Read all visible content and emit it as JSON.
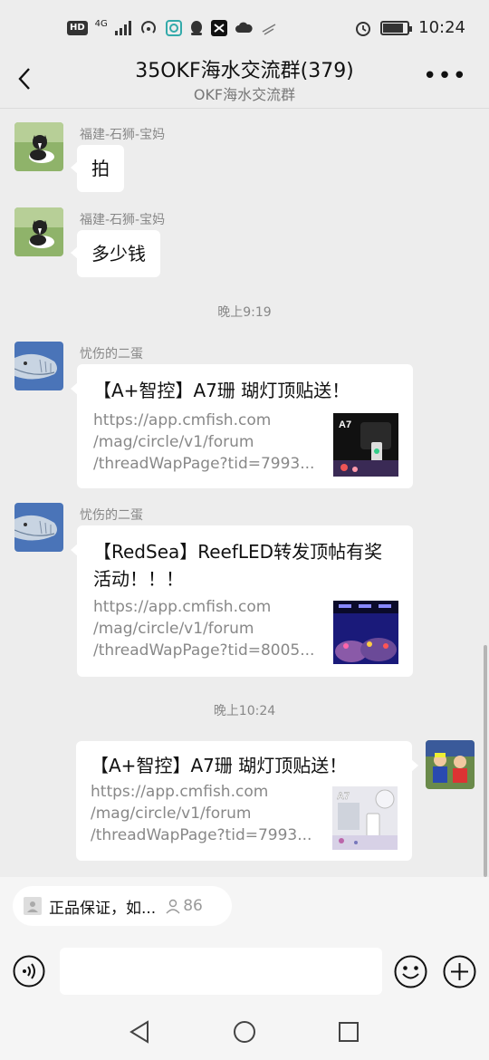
{
  "status_bar": {
    "left_icons": [
      "HD",
      "4G",
      "hotspot-1",
      "app-icon",
      "qq-icon",
      "capcut-icon",
      "cloud-icon",
      "weather-icon"
    ],
    "hd_label": "HD",
    "network_label": "4G",
    "hotspot_badge": "1",
    "time": "10:24",
    "battery_level_pct": 85
  },
  "header": {
    "title": "35OKF海水交流群(379)",
    "subtitle": "OKF海水交流群",
    "more_label": "•••"
  },
  "messages": [
    {
      "type": "text",
      "sender": "福建-石狮-宝妈",
      "text": "拍",
      "avatar": "dog-photo"
    },
    {
      "type": "text",
      "sender": "福建-石狮-宝妈",
      "text": "多少钱",
      "avatar": "dog-photo"
    },
    {
      "type": "timestamp",
      "text": "晚上9:19"
    },
    {
      "type": "link",
      "sender": "忧伤的二蛋",
      "avatar": "fish-drawing",
      "title": "【A+智控】A7珊 瑚灯顶贴送！",
      "desc": "https://app.cmfish.com\n/mag/circle/v1/forum\n/threadWapPage?tid=7993...",
      "thumb_label": "A7"
    },
    {
      "type": "link",
      "sender": "忧伤的二蛋",
      "avatar": "fish-drawing",
      "title": "【RedSea】ReefLED转发顶帖有奖活动！！！",
      "desc": "https://app.cmfish.com\n/mag/circle/v1/forum\n/threadWapPage?tid=8005...",
      "thumb_label": ""
    },
    {
      "type": "timestamp",
      "text": "晚上10:24"
    },
    {
      "type": "link",
      "mine": true,
      "avatar": "kids-photo",
      "title": "【A+智控】A7珊 瑚灯顶贴送！",
      "desc": "https://app.cmfish.com\n/mag/circle/v1/forum\n/threadWapPage?tid=7993...",
      "thumb_label": "A7"
    }
  ],
  "notice": {
    "text": "正品保证，如...",
    "count": "86"
  },
  "input": {
    "placeholder": ""
  },
  "colors": {
    "background": "#ededed",
    "bubble": "#ffffff",
    "meta_text": "#888888"
  }
}
